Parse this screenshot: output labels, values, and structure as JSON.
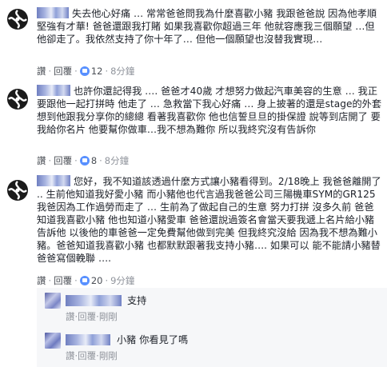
{
  "comments": [
    {
      "text": "失去他心好痛 … 常常爸爸問我為什麼喜歡小豬 我跟爸爸說 因為他孝順堅強有才華! 爸爸還跟我打賭 如果我喜歡你超過三年 他就容應我三個願望 …但他卻走了。我依然支持了你十年了… 但他一個願望也沒替我實現…",
      "like": "讚",
      "reply": "回覆",
      "likes": "12",
      "time": "8分鐘"
    },
    {
      "text": "也許你還記得我 …. 爸爸才40歲 才想努力做起汽車美容的生意 … 我正要跟他一起打拼時 他走了 … 急救當下我心好痛 … 身上披著的還是stage的外套 想到他跟我分享你的總總 看著我喜歡你 他也信誓旦旦的掛保證 說等到店開了 要我給你名片 他要幫你做車…我不想為難你 所以我終究沒有告訴你",
      "like": "讚",
      "reply": "回覆",
      "likes": "8",
      "time": "8分鐘"
    },
    {
      "text": "您好，我不知道該透過什麼方式讓小豬看得到。2/18晚上 我爸爸離開了 .. 生前他知道我好愛小豬 而小豬他也代言過我爸爸公司三陽機車SYM的GR125 我爸因為工作過勞而走了 … 生前為了做起自己的生意 努力打拼 沒多久前 爸爸知道我喜歡小豬 他也知道小豬愛車 爸爸還說過簽名會當天要我遞上名片給小豬 告訴他 以後他的車爸爸一定免費幫他做到完美 但我終究沒給 因為我不想為難小豬。爸爸知道我喜歡小豬 也都默默跟著我支持小豬…. 如果可以 能不能請小豬替爸爸寫個輓聯 ….",
      "like": "讚",
      "reply": "回覆",
      "likes": "20",
      "time": "9分鐘"
    }
  ],
  "replies": [
    {
      "text": "支持",
      "like": "讚",
      "reply": "回覆",
      "time": "剛剛"
    },
    {
      "text": "小豬 你看見了嗎",
      "like": "讚",
      "reply": "回覆",
      "time": "剛剛"
    }
  ],
  "colors": {
    "text": "#1d2129",
    "meta": "#90949c",
    "link": "#4b67a1",
    "like_badge": "#5890ff",
    "reply_bg": "#f6f7f9"
  }
}
